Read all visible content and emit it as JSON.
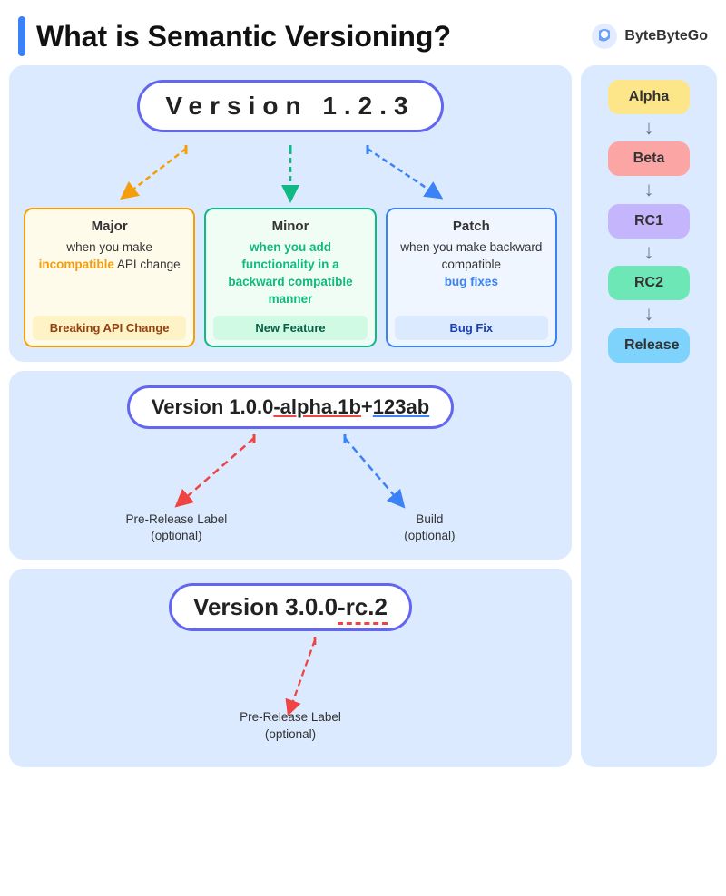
{
  "header": {
    "title": "What is Semantic Versioning?",
    "logo_text": "ByteByteGo"
  },
  "section1": {
    "version_display": "Version 1.2.3",
    "major_label": "Major",
    "minor_label": "Minor",
    "patch_label": "Patch",
    "major_body_normal1": "when you make",
    "major_body_highlight": "incompatible",
    "major_body_normal2": "API change",
    "major_footer": "Breaking API Change",
    "minor_body_highlight": "when you add functionality in a backward compatible manner",
    "minor_footer": "New Feature",
    "patch_body_normal": "when you make backward compatible",
    "patch_body_highlight": "bug fixes",
    "patch_footer": "Bug Fix"
  },
  "section2": {
    "version_display": "Version 1.0.0-alpha.1b+123ab",
    "pre_release_label": "Pre-Release Label\n(optional)",
    "build_label": "Build\n(optional)"
  },
  "section3": {
    "version_display": "Version 3.0.0-rc.2",
    "pre_release_label": "Pre-Release Label\n(optional)"
  },
  "right_panel": {
    "stages": [
      {
        "name": "Alpha",
        "class": "stage-alpha"
      },
      {
        "name": "Beta",
        "class": "stage-beta"
      },
      {
        "name": "RC1",
        "class": "stage-rc1"
      },
      {
        "name": "RC2",
        "class": "stage-rc2"
      },
      {
        "name": "Release",
        "class": "stage-release"
      }
    ]
  }
}
